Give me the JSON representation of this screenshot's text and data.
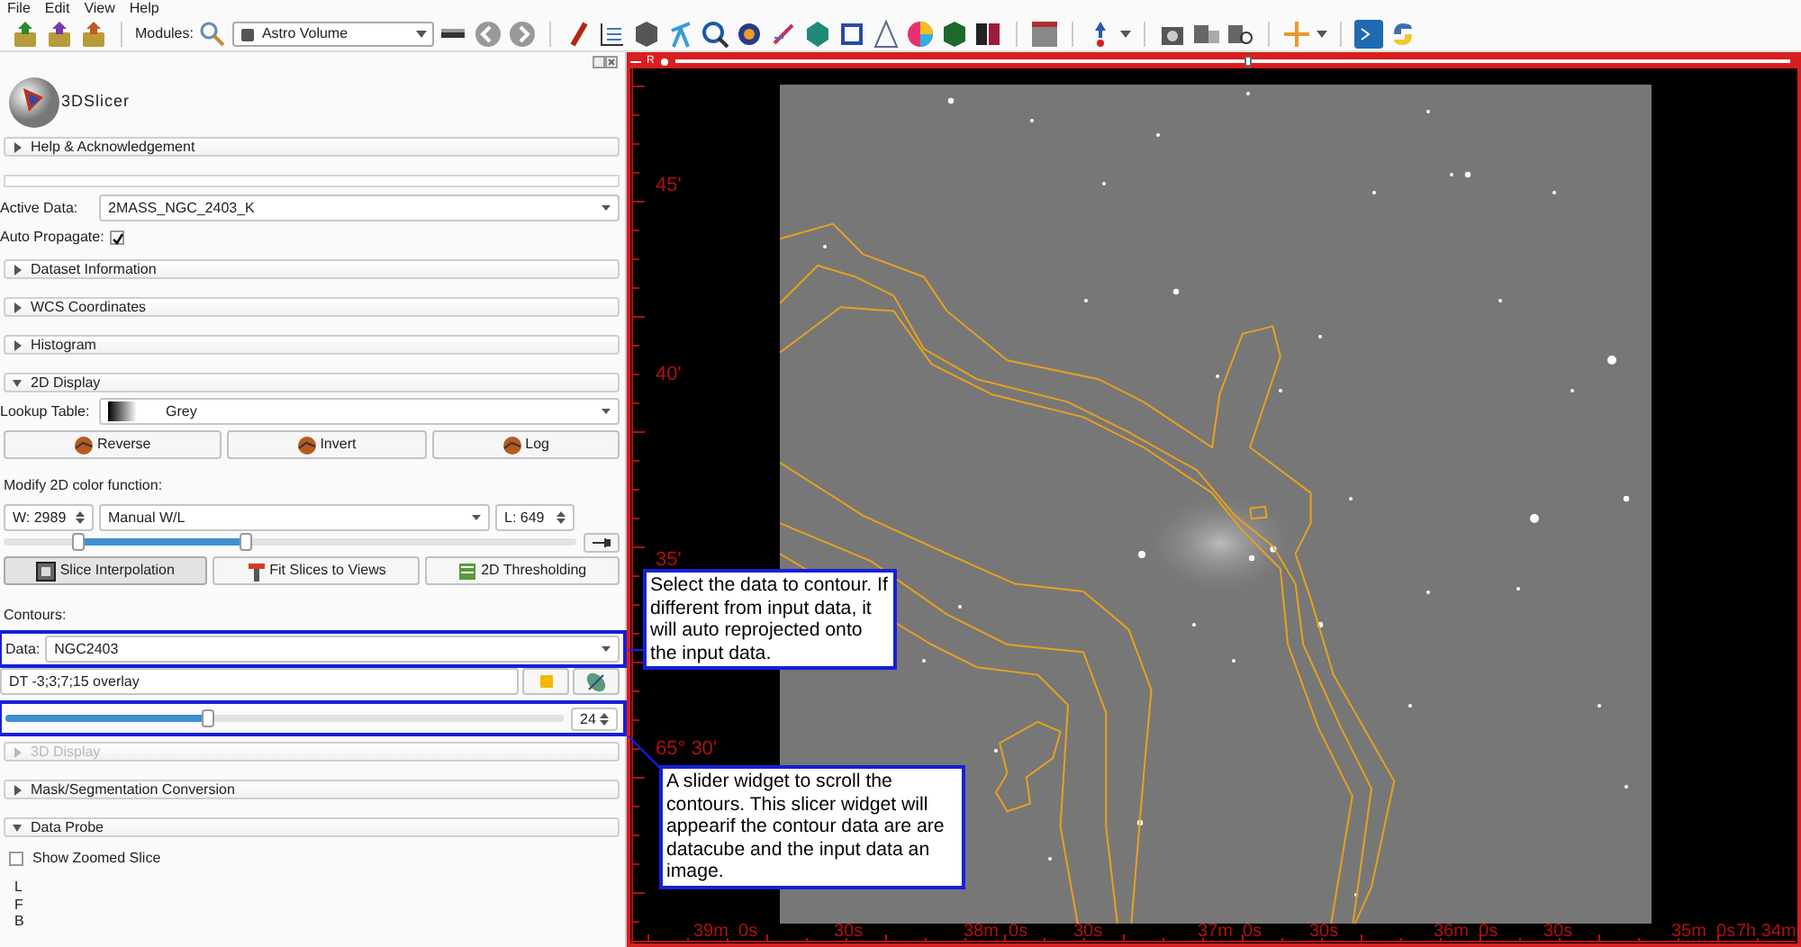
{
  "menu": [
    {
      "label": "File"
    },
    {
      "label": "Edit"
    },
    {
      "label": "View"
    },
    {
      "label": "Help"
    }
  ],
  "toolbar": {
    "modules_label": "Modules:",
    "module": "Astro Volume"
  },
  "logo": {
    "text": "3DSlicer"
  },
  "panel": [
    {
      "kind": "section",
      "title": "Help & Acknowledgement",
      "expanded": false,
      "disabled": false
    },
    {
      "kind": "blank"
    },
    {
      "kind": "combo",
      "label": "Active Data:",
      "value": "2MASS_NGC_2403_K"
    },
    {
      "kind": "checkbox",
      "label": "Auto Propagate:",
      "checked": true
    },
    {
      "kind": "section",
      "title": "Dataset Information",
      "expanded": false,
      "disabled": false
    },
    {
      "kind": "section",
      "title": "WCS Coordinates",
      "expanded": false,
      "disabled": false
    },
    {
      "kind": "section",
      "title": "Histogram",
      "expanded": false,
      "disabled": false
    },
    {
      "kind": "section",
      "title": "2D Display",
      "expanded": true,
      "disabled": false
    },
    {
      "kind": "lut",
      "label": "Lookup Table:",
      "value": "Grey"
    },
    {
      "kind": "buttons",
      "buttons": [
        {
          "label": "Reverse",
          "checked": false
        },
        {
          "label": "Invert",
          "checked": false
        },
        {
          "label": "Log",
          "checked": false
        }
      ]
    },
    {
      "kind": "text",
      "text": "Modify 2D color function:"
    },
    {
      "kind": "wl",
      "window": "W: 2989",
      "preset": "Manual W/L",
      "level_text": "L: 649",
      "thumbs": [
        {
          "level": 0.13
        },
        {
          "level": 0.42
        }
      ]
    },
    {
      "kind": "buttons",
      "buttons": [
        {
          "label": "Slice Interpolation",
          "checked": true
        },
        {
          "label": "Fit Slices to Views",
          "checked": false
        },
        {
          "label": "2D Thresholding",
          "checked": false
        }
      ]
    },
    {
      "kind": "text",
      "text": "Contours:"
    },
    {
      "kind": "combo",
      "label": "Data:",
      "value": "NGC2403"
    },
    {
      "kind": "contour",
      "value": "DT -3;3;7;15 overlay",
      "color": "#f5b800"
    },
    {
      "kind": "slider",
      "level": 0.36,
      "value": "24"
    },
    {
      "kind": "section",
      "title": "3D Display",
      "expanded": false,
      "disabled": true
    },
    {
      "kind": "section",
      "title": "Mask/Segmentation Conversion",
      "expanded": false,
      "disabled": false
    },
    {
      "kind": "section",
      "title": "Data Probe",
      "expanded": true,
      "disabled": false
    },
    {
      "kind": "probe_check",
      "label": "Show Zoomed Slice",
      "checked": false
    },
    {
      "kind": "probe",
      "lines": [
        "L",
        "F",
        "B"
      ]
    }
  ],
  "view": {
    "label": "R",
    "slider": {
      "level": 0.51
    },
    "y_ticks": [
      "45'",
      "40'",
      "35'",
      "65° 30'"
    ],
    "x_ticks": [
      "39m  0s",
      "30s",
      "38m  0s",
      "30s",
      "37m  0s",
      "30s",
      "36m  0s",
      "30s",
      "35m  0s",
      "7h 34m"
    ]
  },
  "callouts": [
    {
      "text": "Select the data to contour. If different from input data, it will auto reprojected onto the input data."
    },
    {
      "text": "A slider widget to scroll the contours. This slicer widget will appearif the contour data are are datacube and the input data an image."
    }
  ]
}
